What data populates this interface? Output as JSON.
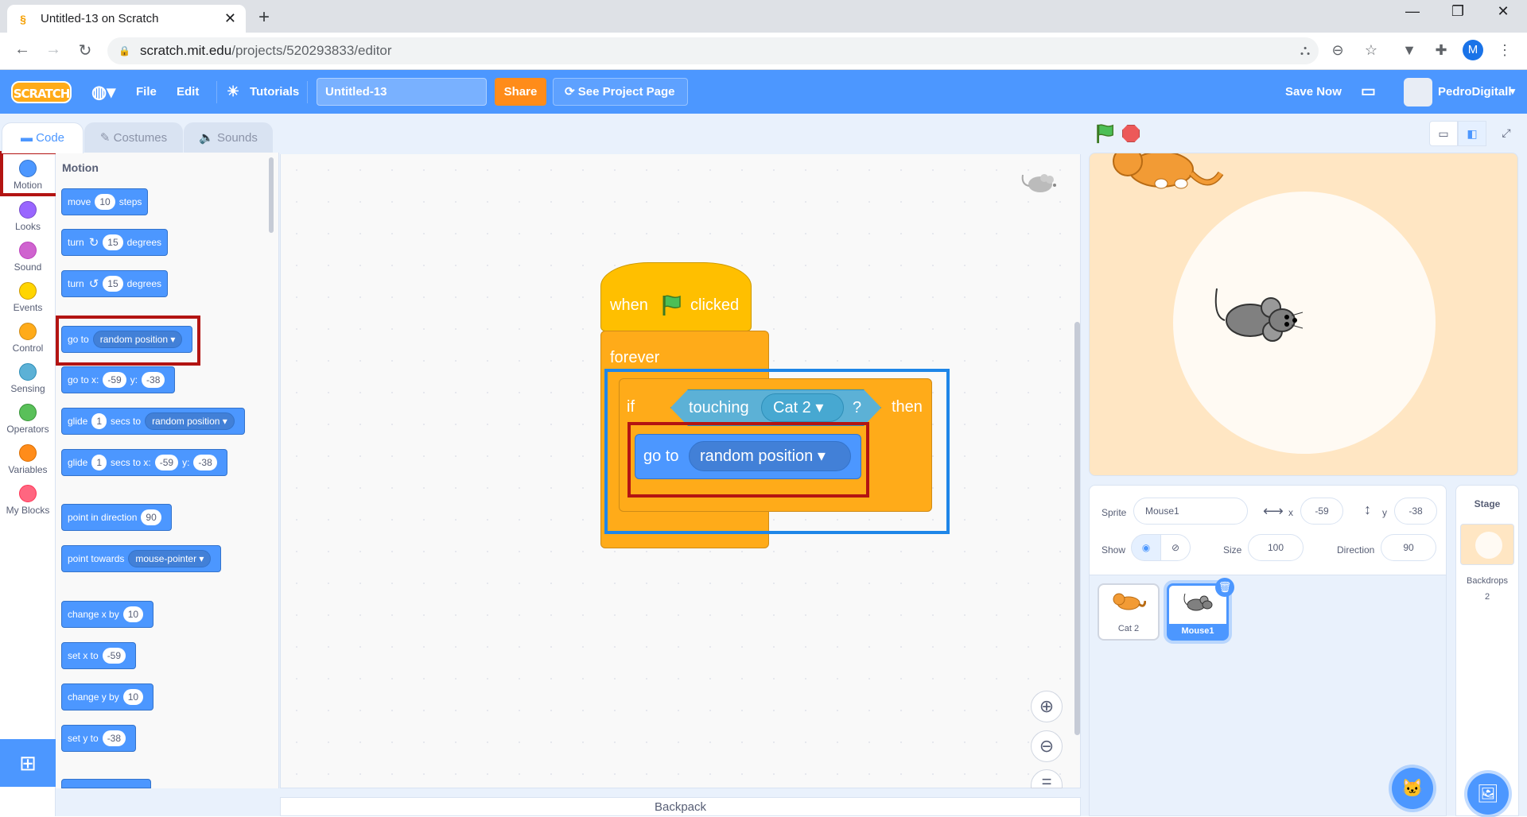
{
  "browser": {
    "tab_title": "Untitled-13 on Scratch",
    "url_host": "scratch.mit.edu",
    "url_path": "/projects/520293833/editor",
    "profile_initial": "M"
  },
  "menubar": {
    "logo": "SCRATCH",
    "file": "File",
    "edit": "Edit",
    "tutorials": "Tutorials",
    "project_title": "Untitled-13",
    "share": "Share",
    "see_project_page": "See Project Page",
    "save_now": "Save Now",
    "username": "PedroDigitall"
  },
  "editor_tabs": [
    "Code",
    "Costumes",
    "Sounds"
  ],
  "categories": [
    {
      "label": "Motion",
      "color": "#4c97ff"
    },
    {
      "label": "Looks",
      "color": "#9966ff"
    },
    {
      "label": "Sound",
      "color": "#cf63cf"
    },
    {
      "label": "Events",
      "color": "#ffd500"
    },
    {
      "label": "Control",
      "color": "#ffab19"
    },
    {
      "label": "Sensing",
      "color": "#5cb1d6"
    },
    {
      "label": "Operators",
      "color": "#59c059"
    },
    {
      "label": "Variables",
      "color": "#ff8c1a"
    },
    {
      "label": "My Blocks",
      "color": "#ff6680"
    }
  ],
  "palette": {
    "heading": "Motion",
    "blocks": {
      "move": {
        "a": "move",
        "v": "10",
        "b": "steps"
      },
      "turn_cw": {
        "a": "turn",
        "v": "15",
        "b": "degrees"
      },
      "turn_ccw": {
        "a": "turn",
        "v": "15",
        "b": "degrees"
      },
      "goto": {
        "a": "go to",
        "dd": "random position"
      },
      "gotoxy": {
        "a": "go to x:",
        "x": "-59",
        "b": "y:",
        "y": "-38"
      },
      "glide": {
        "a": "glide",
        "v": "1",
        "b": "secs to",
        "dd": "random position"
      },
      "glidexy": {
        "a": "glide",
        "v": "1",
        "b": "secs to x:",
        "x": "-59",
        "c": "y:",
        "y": "-38"
      },
      "point_dir": {
        "a": "point in direction",
        "v": "90"
      },
      "point_towards": {
        "a": "point towards",
        "dd": "mouse-pointer"
      },
      "change_x": {
        "a": "change x by",
        "v": "10"
      },
      "set_x": {
        "a": "set x to",
        "v": "-59"
      },
      "change_y": {
        "a": "change y by",
        "v": "10"
      },
      "set_y": {
        "a": "set y to",
        "v": "-38"
      }
    }
  },
  "script": {
    "when": "when",
    "clicked": "clicked",
    "forever": "forever",
    "if": "if",
    "touching": "touching",
    "touching_target": "Cat 2",
    "question": "?",
    "then": "then",
    "goto": "go to",
    "goto_target": "random position"
  },
  "backpack": "Backpack",
  "sprite_info": {
    "sprite_label": "Sprite",
    "sprite_name": "Mouse1",
    "x_label": "x",
    "x": "-59",
    "y_label": "y",
    "y": "-38",
    "show_label": "Show",
    "size_label": "Size",
    "size": "100",
    "direction_label": "Direction",
    "direction": "90"
  },
  "sprites": [
    {
      "name": "Cat 2",
      "selected": false
    },
    {
      "name": "Mouse1",
      "selected": true
    }
  ],
  "stage_pane": {
    "title": "Stage",
    "backdrops_label": "Backdrops",
    "backdrops_count": "2"
  }
}
